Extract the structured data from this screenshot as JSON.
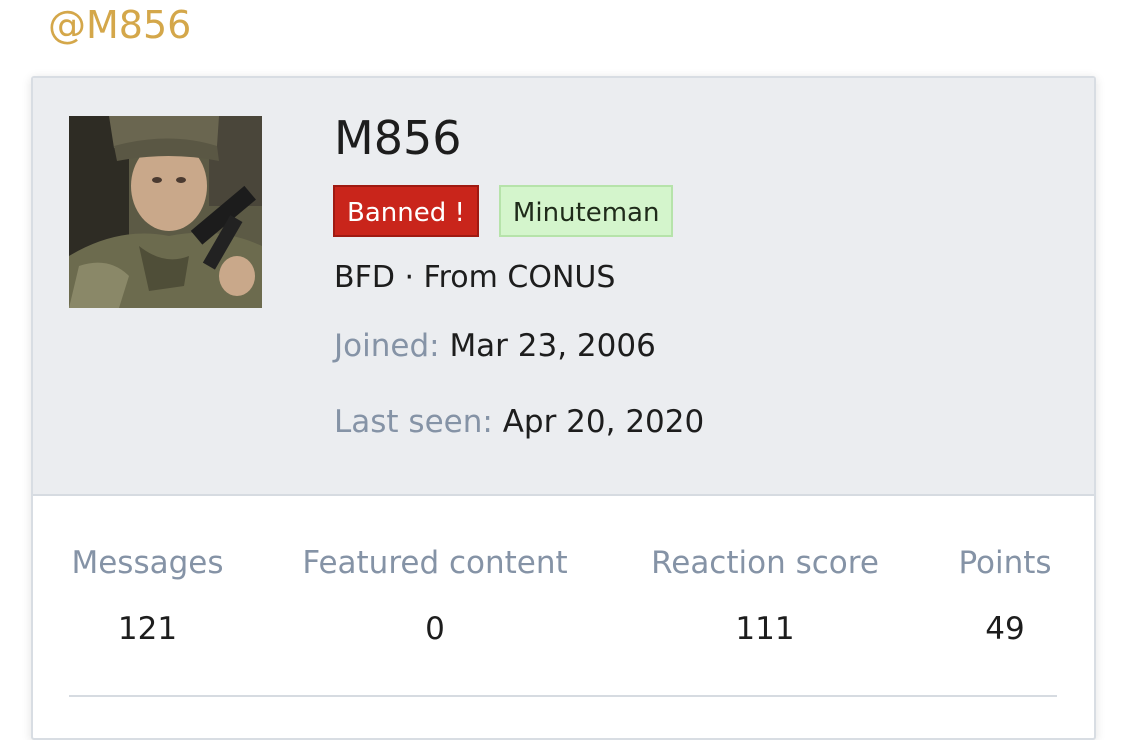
{
  "header": {
    "handle": "@M856"
  },
  "profile": {
    "avatar_alt": "avatar",
    "username": "M856",
    "badges": {
      "banned": "Banned !",
      "group": "Minuteman"
    },
    "blurb": "BFD · From CONUS",
    "joined_label": "Joined:",
    "joined_value": "Mar 23, 2006",
    "last_seen_label": "Last seen:",
    "last_seen_value": "Apr 20, 2020"
  },
  "stats": [
    {
      "label": "Messages",
      "value": "121"
    },
    {
      "label": "Featured content",
      "value": "0"
    },
    {
      "label": "Reaction score",
      "value": "111"
    },
    {
      "label": "Points",
      "value": "49"
    }
  ],
  "colors": {
    "handle": "#d4a74a",
    "banned_bg": "#c9251b",
    "group_bg": "#d4f5cc",
    "muted_label": "#8593a6",
    "card_head_bg": "#ebedf0"
  }
}
